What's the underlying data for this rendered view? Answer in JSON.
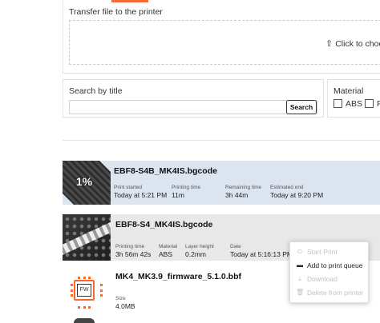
{
  "transfer": {
    "title": "Transfer file to the printer",
    "drop_label": "Click to choose",
    "drop_icon": "upload-arrow"
  },
  "search": {
    "label": "Search by title",
    "placeholder": "",
    "value": "",
    "button_label": "Search"
  },
  "material_filter": {
    "label": "Material",
    "options": [
      {
        "label": "ABS",
        "checked": false
      },
      {
        "label": "F",
        "checked": false
      }
    ]
  },
  "jobs": [
    {
      "filename": "EBF8-S4B_MK4IS.bgcode",
      "progress_label": "1%",
      "progress": 0.01,
      "fields": [
        {
          "key": "Print started",
          "value": "Today at 5:21 PM"
        },
        {
          "key": "Printing time",
          "value": "11m"
        },
        {
          "key": "Remaining time",
          "value": "3h 44m"
        },
        {
          "key": "Estimated end",
          "value": "Today at 9:20 PM"
        }
      ]
    },
    {
      "filename": "EBF8-S4_MK4IS.bgcode",
      "fields": [
        {
          "key": "Printing time",
          "value": "3h 56m 42s"
        },
        {
          "key": "Material",
          "value": "ABS"
        },
        {
          "key": "Layer height",
          "value": "0.2mm"
        },
        {
          "key": "Date",
          "value": "Today at 5:16:13 PM"
        }
      ]
    },
    {
      "filename": "MK4_MK3.9_firmware_5.1.0.bbf",
      "thumb_label": "FW",
      "fields": [
        {
          "key": "Size",
          "value": "4.0MB"
        }
      ]
    }
  ],
  "context_menu": {
    "items": [
      {
        "label": "Start Print",
        "icon": "start-print-icon",
        "enabled": false
      },
      {
        "label": "Add to print queue",
        "icon": "add-queue-icon",
        "enabled": true
      },
      {
        "label": "Download",
        "icon": "download-icon",
        "enabled": false
      },
      {
        "label": "Delete from printer",
        "icon": "trash-icon",
        "enabled": false
      }
    ]
  },
  "colors": {
    "accent": "#fa6831",
    "active_row": "#dbe4ef",
    "hover_row": "#e8e8e8",
    "disabled_text": "#c2c2c2"
  }
}
